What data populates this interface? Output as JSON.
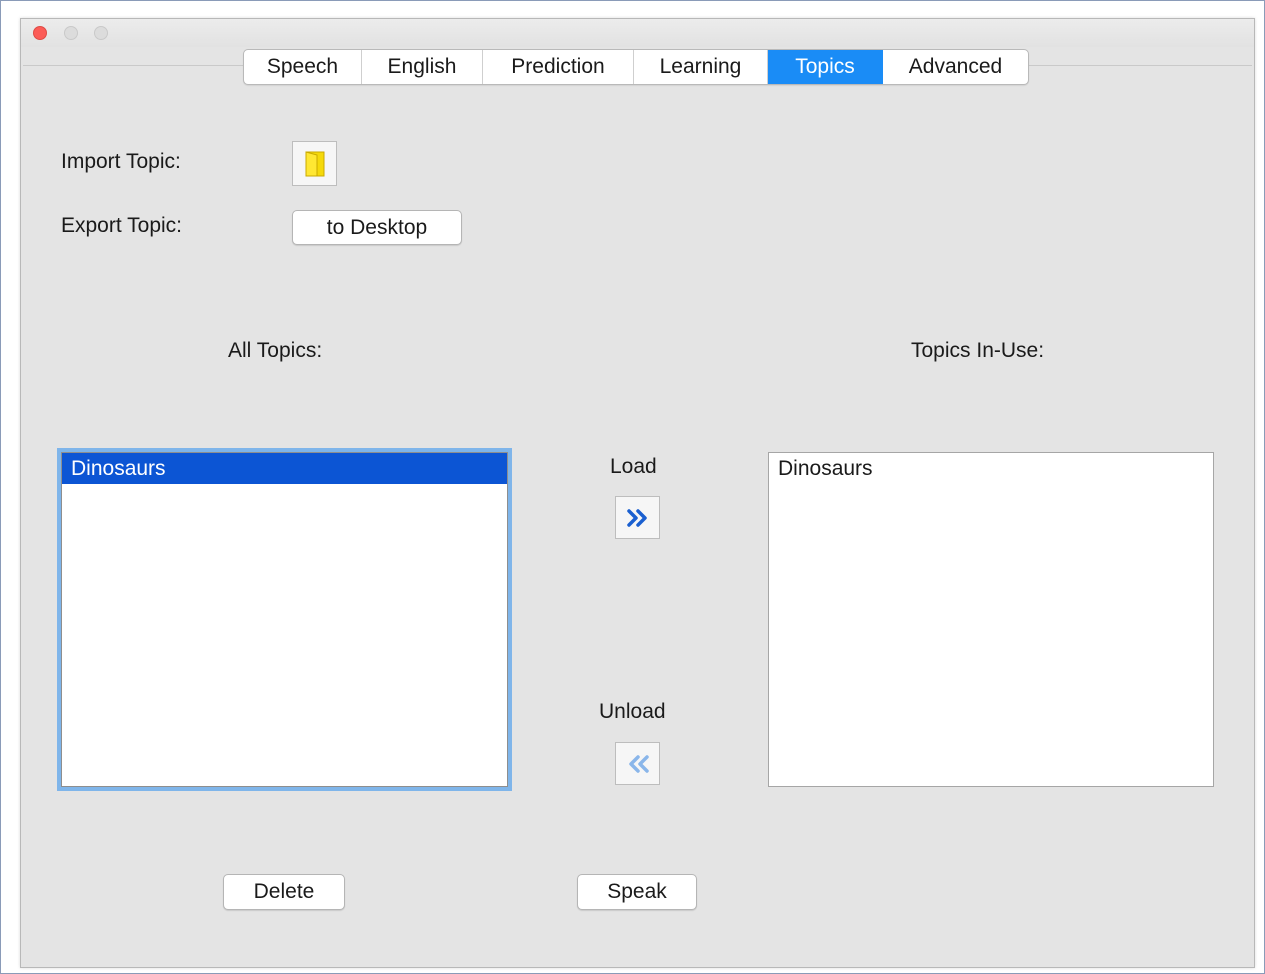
{
  "window": {
    "traffic_lights": [
      "close",
      "minimize",
      "zoom"
    ],
    "colors": {
      "close": "#fc5c57",
      "inactive": "#dcdcdc",
      "accent": "#1a8cf6",
      "selection": "#0c55d4"
    }
  },
  "tabs": [
    {
      "label": "Speech",
      "active": false
    },
    {
      "label": "English",
      "active": false
    },
    {
      "label": "Prediction",
      "active": false
    },
    {
      "label": "Learning",
      "active": false
    },
    {
      "label": "Topics",
      "active": true
    },
    {
      "label": "Advanced",
      "active": false
    }
  ],
  "import": {
    "label": "Import Topic:",
    "icon": "folder-icon"
  },
  "export": {
    "label": "Export Topic:",
    "button_label": "to Desktop"
  },
  "all_topics": {
    "heading": "All Topics:",
    "items": [
      {
        "label": "Dinosaurs",
        "selected": true
      }
    ]
  },
  "topics_in_use": {
    "heading": "Topics In-Use:",
    "items": [
      {
        "label": "Dinosaurs",
        "selected": false
      }
    ]
  },
  "load": {
    "label": "Load",
    "icon": "double-chevron-right-icon"
  },
  "unload": {
    "label": "Unload",
    "icon": "double-chevron-left-icon"
  },
  "footer": {
    "delete_label": "Delete",
    "speak_label": "Speak"
  }
}
